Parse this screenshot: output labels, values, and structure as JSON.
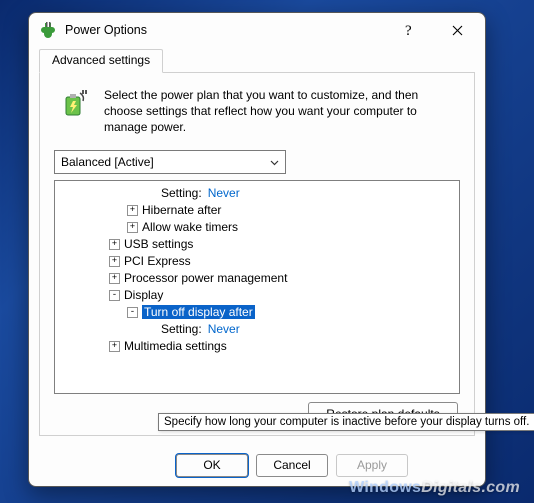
{
  "window": {
    "title": "Power Options"
  },
  "tab": {
    "label": "Advanced settings"
  },
  "intro": "Select the power plan that you want to customize, and then choose settings that reflect how you want your computer to manage power.",
  "plan_selected": "Balanced [Active]",
  "tree": {
    "setting_label": "Setting:",
    "never": "Never",
    "hibernate": "Hibernate after",
    "allow_wake": "Allow wake timers",
    "usb": "USB settings",
    "pci": "PCI Express",
    "proc": "Processor power management",
    "display": "Display",
    "turn_off_display": "Turn off display after",
    "turn_off_setting_label": "Setting:",
    "turn_off_value": "Never",
    "multimedia": "Multimedia settings"
  },
  "tooltip": "Specify how long your computer is inactive before your display turns off.",
  "buttons": {
    "restore": "Restore plan defaults",
    "ok": "OK",
    "cancel": "Cancel",
    "apply": "Apply"
  },
  "watermark": {
    "a": "Windows",
    "b": "Digitals",
    "c": ".com"
  }
}
